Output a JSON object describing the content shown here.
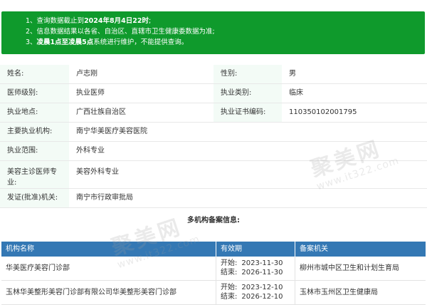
{
  "notice": {
    "line1": {
      "num": "1、",
      "pre": "查询数据截止到",
      "bold": "2024年8月4日22时",
      "post": ";"
    },
    "line2": {
      "num": "2、",
      "text": "信息数据结果以各省、自治区、直辖市卫生健康委数据为准;"
    },
    "line3": {
      "num": "3、",
      "bold": "凌晨1点至凌晨5点",
      "post": "系统进行维护，不能提供查询。"
    }
  },
  "info": {
    "name_label": "姓名:",
    "name_value": "卢志刚",
    "gender_label": "性别:",
    "gender_value": "男",
    "level_label": "医师级别:",
    "level_value": "执业医师",
    "category_label": "执业类别:",
    "category_value": "临床",
    "location_label": "执业地点:",
    "location_value": "广西壮族自治区",
    "cert_label": "执业证书编码:",
    "cert_value": "110350102001795",
    "org_label": "主要执业机构:",
    "org_value": "南宁华美医疗美容医院",
    "scope_label": "执业范围:",
    "scope_value": "外科专业",
    "chief_label_1": "美容主诊医师专",
    "chief_label_2": "业:",
    "chief_value": "美容外科专业",
    "issuer_label": "发证(批准)机关:",
    "issuer_value": "南宁市行政审批局"
  },
  "multi_title": "多机构备案信息:",
  "records": {
    "headers": [
      "机构名称",
      "有效期",
      "备案机关"
    ],
    "rows": [
      {
        "name": "华美医疗美容门诊部",
        "start_label": "开始:",
        "start": "2023-11-30",
        "end_label": "结束:",
        "end": "2026-11-30",
        "authority": "柳州市城中区卫生和计划生育局"
      },
      {
        "name": "玉林华美整形美容门诊部有限公司华美整形美容门诊部",
        "start_label": "开始:",
        "start": "2023-12-10",
        "end_label": "结束:",
        "end": "2026-12-10",
        "authority": "玉林市玉州区卫生健康局"
      }
    ]
  },
  "watermark": {
    "brand": "聚美网",
    "url": "www.it322.com"
  },
  "colors": {
    "notice_bg": "#0f9a2c",
    "label_bg": "#f3fbf6",
    "table_header_bg": "#3478b4"
  }
}
